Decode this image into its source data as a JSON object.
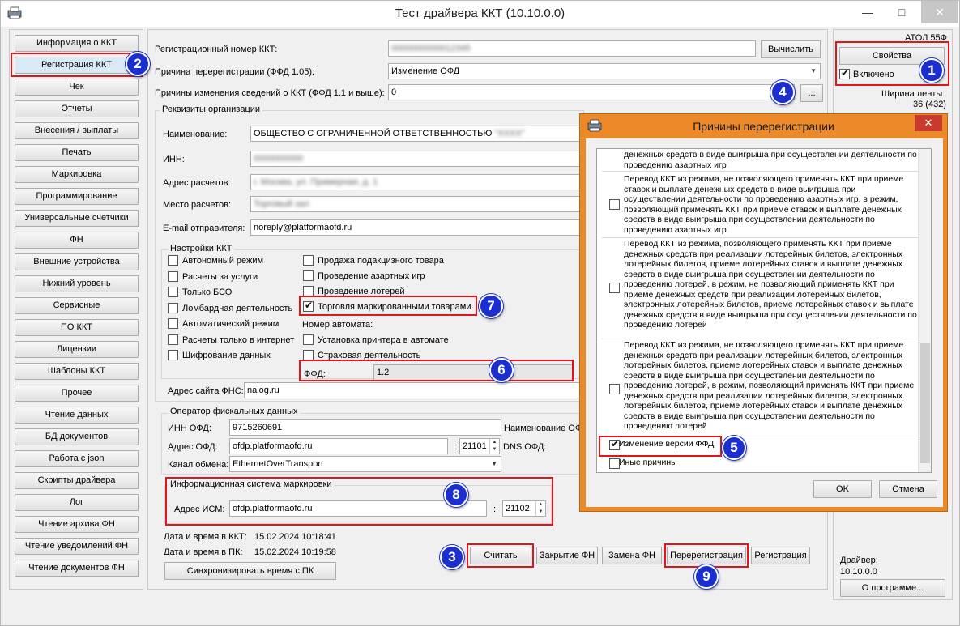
{
  "window": {
    "title": "Тест драйвера ККТ (10.10.0.0)",
    "min": "—",
    "max": "□",
    "close": "✕"
  },
  "nav": [
    "Информация о ККТ",
    "Регистрация ККТ",
    "Чек",
    "Отчеты",
    "Внесения / выплаты",
    "Печать",
    "Маркировка",
    "Программирование",
    "Универсальные счетчики",
    "ФН",
    "Внешние устройства",
    "Нижний уровень",
    "Сервисные",
    "ПО ККТ",
    "Лицензии",
    "Шаблоны ККТ",
    "Прочее",
    "Чтение данных",
    "БД документов",
    "Работа с json",
    "Скрипты драйвера",
    "Лог",
    "Чтение архива ФН",
    "Чтение уведомлений ФН",
    "Чтение документов ФН"
  ],
  "form": {
    "reg_num_label": "Регистрационный номер ККТ:",
    "reg_num_value": "0000000000012345",
    "calc_button": "Вычислить",
    "reason_label": "Причина перерегистрации (ФФД 1.05):",
    "reason_value": "Изменение ОФД",
    "change_label": "Причины изменения сведений о ККТ (ФФД 1.1 и выше):",
    "change_value": "0",
    "more_button": "...",
    "org_group": "Реквизиты организации",
    "name_label": "Наименование:",
    "name_value": "ОБЩЕСТВО С ОГРАНИЧЕННОЙ ОТВЕТСТВЕННОСТЬЮ",
    "name_hidden": "\"XXXX\"",
    "inn_label": "ИНН:",
    "inn_value": "0000000000",
    "addr_label": "Адрес расчетов:",
    "addr_value": "г. Москва, ул. Примерная, д. 1",
    "place_label": "Место расчетов:",
    "place_value": "Торговый зал",
    "email_label": "E-mail отправителя:",
    "email_value": "noreply@platformaofd.ru",
    "settings_group": "Настройки ККТ",
    "checks_left": [
      {
        "label": "Автономный режим",
        "checked": false
      },
      {
        "label": "Расчеты за услуги",
        "checked": false
      },
      {
        "label": "Только БСО",
        "checked": false
      },
      {
        "label": "Ломбардная деятельность",
        "checked": false
      },
      {
        "label": "Автоматический режим",
        "checked": false
      },
      {
        "label": "Расчеты только в интернет",
        "checked": false
      },
      {
        "label": "Шифрование данных",
        "checked": false
      }
    ],
    "checks_right": [
      {
        "label": "Продажа подакцизного товара",
        "checked": false
      },
      {
        "label": "Проведение азартных игр",
        "checked": false
      },
      {
        "label": "Проведение лотерей",
        "checked": false
      },
      {
        "label": "Торговля маркированными товарами",
        "checked": true
      }
    ],
    "auto_num_label": "Номер автомата:",
    "checks_right2": [
      {
        "label": "Установка принтера в автомате",
        "checked": false
      },
      {
        "label": "Страховая деятельность",
        "checked": false
      }
    ],
    "ffd_label": "ФФД:",
    "ffd_value": "1.2",
    "fns_label": "Адрес сайта ФНС:",
    "fns_value": "nalog.ru",
    "ofd_group": "Оператор фискальных данных",
    "ofd_inn_label": "ИНН ОФД:",
    "ofd_inn_value": "9715260691",
    "ofd_name_label": "Наименование ОФ",
    "ofd_addr_label": "Адрес ОФД:",
    "ofd_addr_value": "ofdp.platformaofd.ru",
    "ofd_colon": ":",
    "ofd_port": "21101",
    "ofd_dns_label": "DNS ОФД:",
    "channel_label": "Канал обмена:",
    "channel_value": "EthernetOverTransport",
    "ism_group": "Информационная система маркировки",
    "ism_label": "Адрес ИСМ:",
    "ism_value": "ofdp.platformaofd.ru",
    "ism_colon": ":",
    "ism_port": "21102",
    "kkt_dt_label": "Дата и время в ККТ:",
    "kkt_dt_value": "15.02.2024 10:18:41",
    "pc_dt_label": "Дата и время в ПК:",
    "pc_dt_value": "15.02.2024 10:19:58",
    "sync_button": "Синхронизировать время с ПК"
  },
  "actions": [
    "Считать",
    "Закрытие ФН",
    "Замена ФН",
    "Перерегистрация",
    "Регистрация"
  ],
  "right": {
    "model": "АТОЛ 55Ф",
    "props_button": "Свойства",
    "enabled_label": "Включено",
    "tape_label": "Ширина ленты:",
    "tape_value": "36 (432)",
    "driver_label": "Драйвер:",
    "driver_value": "10.10.0.0",
    "about_button": "О программе..."
  },
  "dialog": {
    "title": "Причины перерегистрации",
    "close": "✕",
    "items": [
      {
        "text": "денежных средств в виде выигрыша при осуществлении деятельности по проведению азартных игр",
        "checked": null
      },
      {
        "text": "Перевод ККТ из режима, не позволяющего применять ККТ при приеме ставок и выплате денежных средств в виде выигрыша при осуществлении деятельности по проведению азартных игр, в режим, позволяющий применять ККТ при приеме ставок и выплате денежных средств в виде выигрыша при осуществлении деятельности по проведению азартных игр",
        "checked": false
      },
      {
        "text": "Перевод ККТ из режима, позволяющего применять ККТ при приеме денежных средств при реализации лотерейных билетов, электронных лотерейных билетов, приеме лотерейных ставок и выплате денежных средств в виде выигрыша при осуществлении деятельности по проведению лотерей, в режим, не позволяющий применять ККТ при приеме денежных средств при реализации лотерейных билетов, электронных лотерейных билетов, приеме лотерейных ставок и выплате денежных средств в виде выигрыша при осуществлении деятельности по проведению лотерей",
        "checked": false
      },
      {
        "text": "Перевод ККТ из режима, не позволяющего применять ККТ при приеме денежных средств при реализации лотерейных билетов, электронных лотерейных билетов, приеме лотерейных ставок и выплате денежных средств в виде выигрыша при осуществлении деятельности по проведению лотерей, в режим, позволяющий применять ККТ при приеме денежных средств при реализации лотерейных билетов, электронных лотерейных билетов, приеме лотерейных ставок и выплате денежных средств в виде выигрыша при осуществлении деятельности по проведению лотерей",
        "checked": false
      },
      {
        "text": "Изменение версии ФФД",
        "checked": true
      },
      {
        "text": "Иные причины",
        "checked": false
      }
    ],
    "ok": "OK",
    "cancel": "Отмена"
  },
  "badges": [
    "1",
    "2",
    "3",
    "4",
    "5",
    "6",
    "7",
    "8",
    "9"
  ],
  "colors": {
    "highlight": "#e3141b",
    "badge": "#1b2fd1",
    "dialog_frame": "#ec8a2a"
  }
}
